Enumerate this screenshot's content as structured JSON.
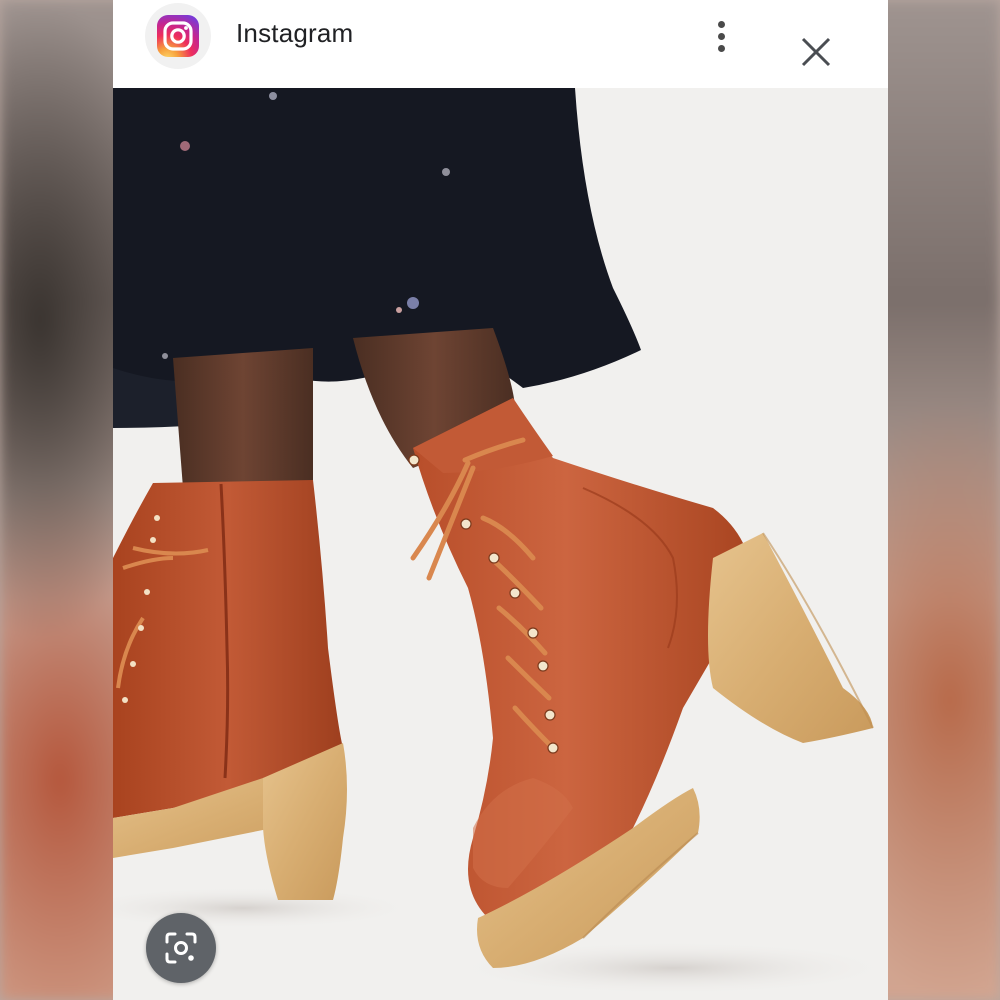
{
  "header": {
    "app_name": "Instagram",
    "app_icon": "instagram-icon",
    "more_icon": "more-vert-icon",
    "close_icon": "close-icon"
  },
  "image": {
    "subject": "photo",
    "colors": {
      "boot_leather": "#b9502f",
      "heel_wood": "#d9b27a",
      "skirt": "#151822",
      "background": "#f3f2f0"
    }
  },
  "overlay": {
    "lens_icon": "google-lens-icon"
  }
}
